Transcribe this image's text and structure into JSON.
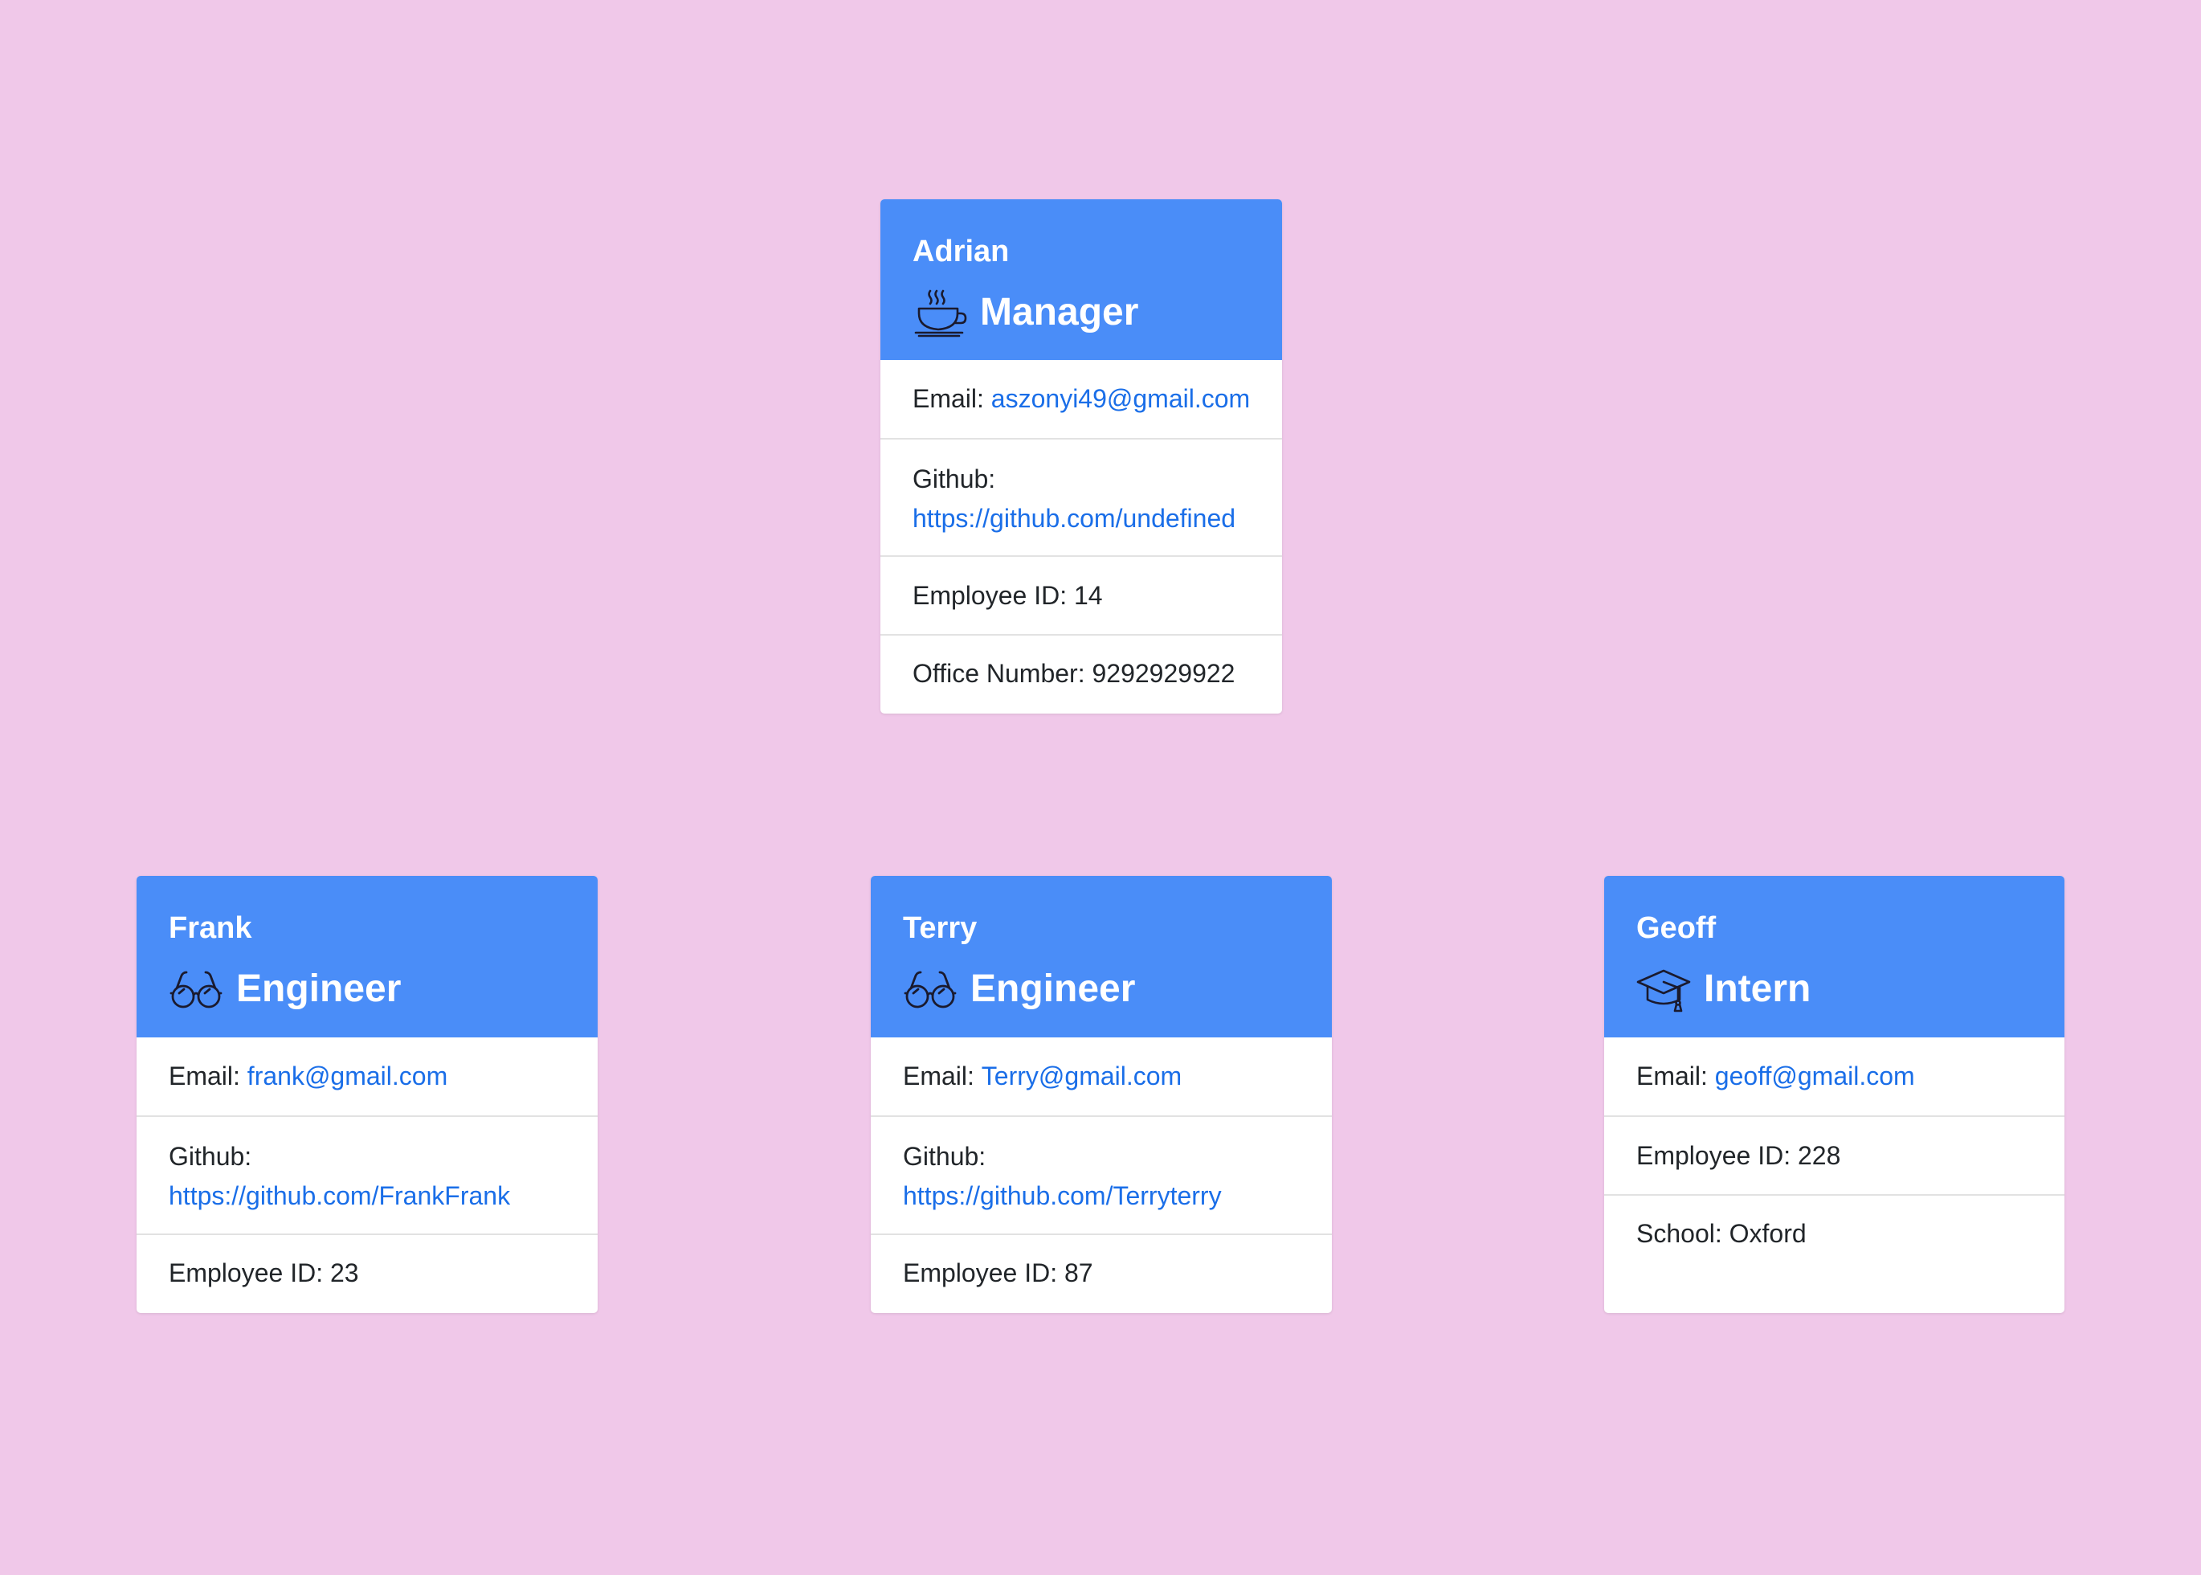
{
  "manager": {
    "name": "Adrian",
    "role": "Manager",
    "role_icon": "coffee-cup-icon",
    "email_label": "Email: ",
    "email": "aszonyi49@gmail.com",
    "github_label": "Github:",
    "github": "https://github.com/undefined",
    "id_text": "Employee ID: 14",
    "office_text": "Office Number: 9292929922"
  },
  "engineers": [
    {
      "name": "Frank",
      "role": "Engineer",
      "role_icon": "glasses-icon",
      "email_label": "Email: ",
      "email": "frank@gmail.com",
      "github_label": "Github:",
      "github": "https://github.com/FrankFrank",
      "id_text": "Employee ID: 23"
    },
    {
      "name": "Terry",
      "role": "Engineer",
      "role_icon": "glasses-icon",
      "email_label": "Email: ",
      "email": "Terry@gmail.com",
      "github_label": "Github:",
      "github": "https://github.com/Terryterry",
      "id_text": "Employee ID: 87"
    }
  ],
  "intern": {
    "name": "Geoff",
    "role": "Intern",
    "role_icon": "graduation-cap-icon",
    "email_label": "Email: ",
    "email": "geoff@gmail.com",
    "id_text": "Employee ID: 228",
    "school_text": "School: Oxford"
  },
  "colors": {
    "background": "#f0c8e9",
    "header": "#4a8df8",
    "link": "#1a6ee8",
    "text": "#212529"
  }
}
